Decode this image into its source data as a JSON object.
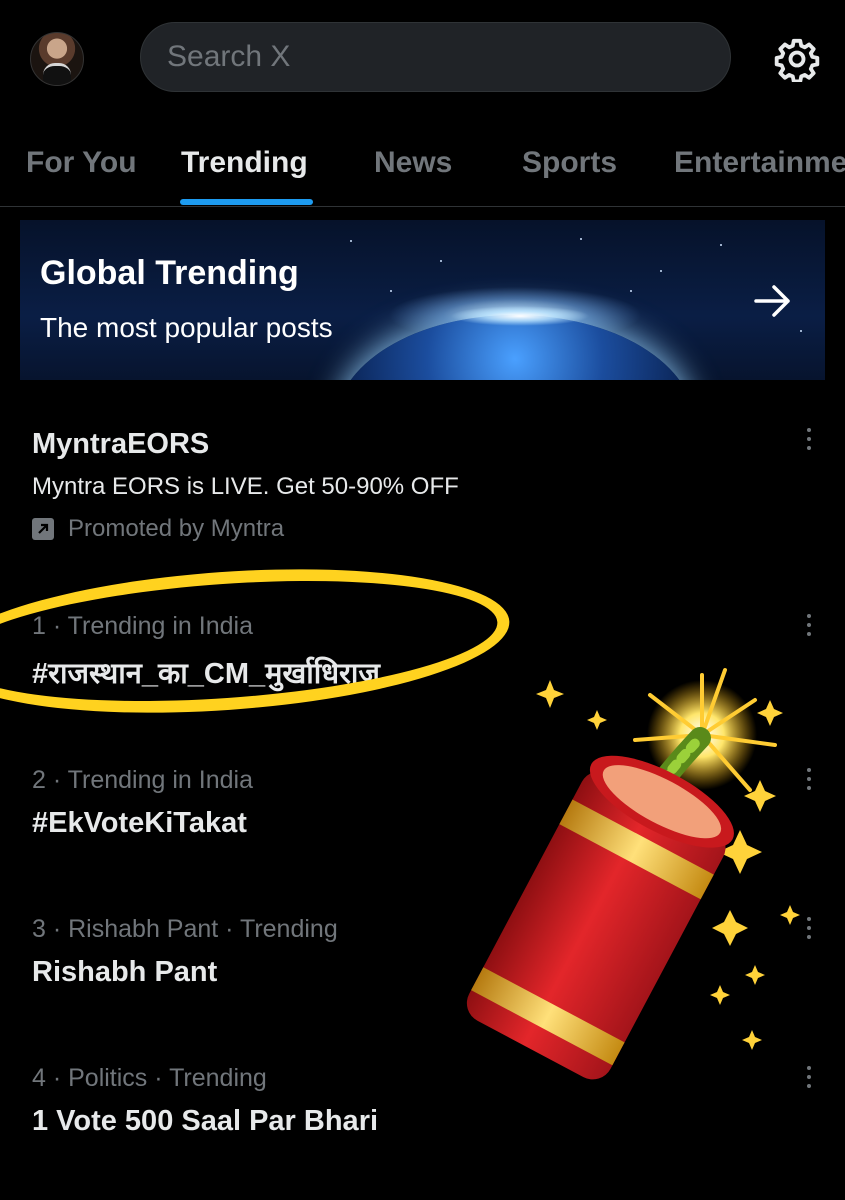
{
  "search": {
    "placeholder": "Search X"
  },
  "tabs": [
    {
      "label": "For You",
      "active": false
    },
    {
      "label": "Trending",
      "active": true
    },
    {
      "label": "News",
      "active": false
    },
    {
      "label": "Sports",
      "active": false
    },
    {
      "label": "Entertainme",
      "active": false
    }
  ],
  "banner": {
    "title": "Global Trending",
    "subtitle": "The most popular posts"
  },
  "promoted": {
    "title": "MyntraEORS",
    "description": "Myntra EORS is LIVE. Get 50-90% OFF",
    "promoted_by": "Promoted by Myntra"
  },
  "trends": [
    {
      "meta": "1 · Trending in India",
      "title": "#राजस्थान_का_CM_मुर्खाधिराज"
    },
    {
      "meta": "2 · Trending in India",
      "title": "#EkVoteKiTakat"
    },
    {
      "meta": "3 · Rishabh Pant · Trending",
      "title": "Rishabh Pant"
    },
    {
      "meta": "4 · Politics · Trending",
      "title": "1 Vote 500 Saal Par Bhari"
    }
  ],
  "colors": {
    "accent": "#1d9bf0",
    "highlight_ring": "#ffd21f",
    "background": "#000000",
    "muted_text": "#71767b"
  },
  "icons": [
    "settings-gear-icon",
    "arrow-right-icon",
    "promoted-arrow-icon",
    "more-options-icon",
    "firecracker-emoji"
  ]
}
